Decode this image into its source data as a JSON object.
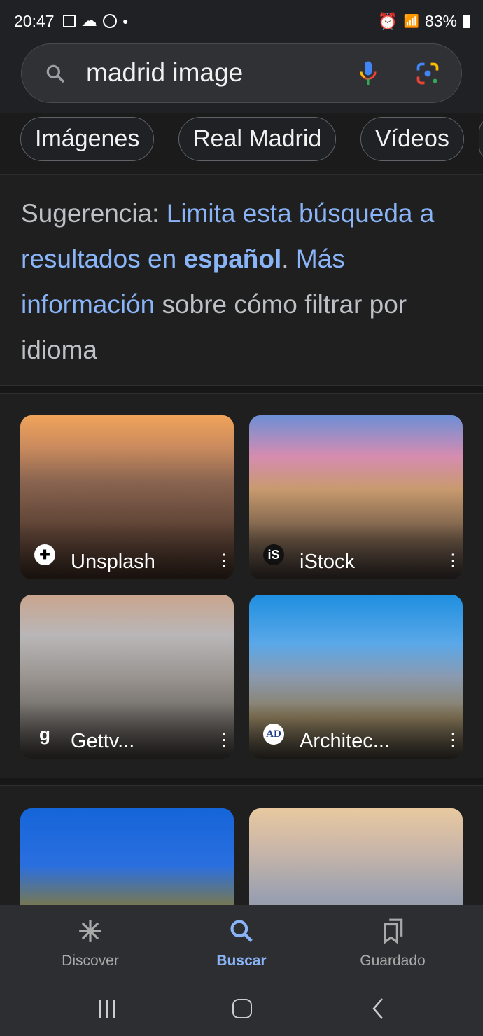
{
  "status": {
    "time": "20:47",
    "battery": "83%"
  },
  "search": {
    "query": "madrid image"
  },
  "chips": [
    "Imágenes",
    "Real Madrid",
    "Vídeos"
  ],
  "suggestion": {
    "prefix": "Sugerencia: ",
    "link1": "Limita esta búsqueda a resultados en ",
    "link1_bold": "español",
    "sep": ". ",
    "link2": "Más información",
    "suffix": " sobre cómo filtrar por idioma"
  },
  "images": [
    {
      "source": "Unsplash",
      "favicon": "unsplash-icon"
    },
    {
      "source": "iStock",
      "favicon": "iS"
    },
    {
      "source": "Gettv...",
      "favicon": "g"
    },
    {
      "source": "Architec...",
      "favicon": "AD"
    }
  ],
  "nav": {
    "tabs": [
      {
        "label": "Discover",
        "icon": "asterisk-icon"
      },
      {
        "label": "Buscar",
        "icon": "search-icon",
        "active": true
      },
      {
        "label": "Guardado",
        "icon": "bookmarks-icon"
      }
    ]
  },
  "colors": {
    "accent": "#8ab4f8",
    "background": "#1f1f1f"
  }
}
